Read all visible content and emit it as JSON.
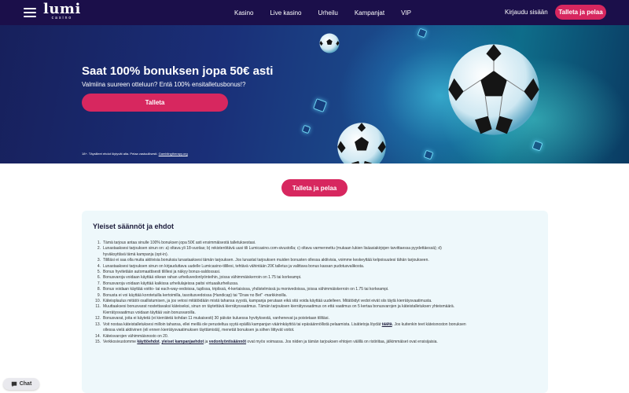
{
  "header": {
    "logo_main": "lumi",
    "logo_sub": "casino",
    "nav": [
      "Kasino",
      "Live kasino",
      "Urheilu",
      "Kampanjat",
      "VIP"
    ],
    "login_label": "Kirjaudu sisään",
    "deposit_label": "Talleta ja pelaa"
  },
  "hero": {
    "title": "Saat 100% bonuksen jopa 50€ asti",
    "subtitle": "Valmiina suureen otteluun? Entä 100% ensitalletusbonus!?",
    "cta_label": "Talleta",
    "legal_prefix": "18+. Täysilleet ehdot löytyvät alta. Pelaa vastuullisesti. ",
    "legal_link": "Gamblingtherapy.org"
  },
  "main_cta_label": "Talleta ja pelaa",
  "terms": {
    "title": "Yleiset säännöt ja ehdot",
    "items": [
      {
        "num": "1.",
        "text": "Tämä tarjous antaa sinulle 100% bonuksen jopa 50€ asti ensimmäisestä talletuksestasi."
      },
      {
        "num": "2.",
        "text": "Lunastaaksesi tarjouksen sinun on: a) oltava yli 18-vuotias; b) rekisteröitävä uusi tili Lumicasino.com-sivustolla; c) oltava varmennettu (mukaan lukien lisäasiakirjojen tarvittaessa pyydettäessä); d)",
        "cont": "hyväksyttävä tämä kampanja (opt-in)."
      },
      {
        "num": "3.",
        "text": "Tililläsi ei saa olla muita aktiivisia bonuksia lunastaaksesi tämän tarjouksen. Jos lunastat tarjouksen muiden bonusten ollessa aktiivisia, voimme keskeyttää kelpoisuutesi tähän tarjoukseen."
      },
      {
        "num": "4.",
        "text": "Lunastaaksesi tarjouksen sinun on kirjauduttava uudelle Lumicasino-tilillesi, tehtävä vähintään 20€ talletus ja valittava bonus kassan pudotusvalikosta."
      },
      {
        "num": "5.",
        "text": "Bonus hyvitetään automaattisesti tilillesi ja näkyy bonus-saldossasi."
      },
      {
        "num": "6.",
        "text": "Bonusvaroja voidaan käyttää oikean rahan urheiluvedonlyönteihin, joissa vähimmäiskerroin on 1.75 tai korkeampi."
      },
      {
        "num": "7.",
        "text": "Bonusvaroja voidaan käyttää kaikissa urheilulajeissa paitsi virtuaaliurheilussa."
      },
      {
        "num": "8.",
        "text": "Bonus voidaan käyttää voitto- tai each-way-vedoissa, tuplissa, triplissä, 4-kertaisissa, yhdistelmissä ja monivedoissa, joissa vähimmäiskerroin on 1.75 tai korkeampi."
      },
      {
        "num": "9.",
        "text": "Bonusta ei voi käyttää korotetuilla kertoimilla, tasoitusvedoissa (Handicap) tai \"Draw no Bet\" -markkinoilla."
      },
      {
        "num": "10.",
        "text": "Käteisplaulus mitätöi osallistumisen, ja jos vetosi mitätöidään mistä tahansa syystä, kampanja perutaan eikä sitä voida käyttää uudelleen. Mitätöidyt vedot eivät siis täytä kierrätysvaatimusta."
      },
      {
        "num": "11.",
        "text": "Muuttaaksesi bonusvarat nostettavaksi käteiseksi, sinun on täytettävä kierrätysvaatimus. Tämän tarjouksen kierrätysvaatimus on että vaatimus on 5 kertaa bonusvarojen ja käteistalletuksen yhteismäärä.",
        "cont": "Kierrätysvaatimus voidaan täyttää vain bonusvaroilla."
      },
      {
        "num": "12.",
        "text": "Bonusvarat, joita ei käytetä (ei kierrätetä kohdan 11 mukaisesti) 30 päivän kuluessa hyvityksestä, vanhenevat ja poistetaan tililtäsi."
      },
      {
        "num": "13.",
        "text_before": "Voit nostaa käteistalletuksesi milloin tahansa, ellei meillä ole perusteltua syytä epäillä kampanjan väärinkäyttöä tai epäsäännöllistä pelaamista. Lisätietoja löydät ",
        "link": "täältä",
        "text_after": ". Jos kuitenkin teet käteisnoston bonuksen",
        "cont": "ollessa vielä aktiivinen (eli ennen kierrätysvaatimuksen täyttämistä), menetät bonuksen ja siihen liittyvät voitot."
      },
      {
        "num": "14.",
        "text": "Käteisvarojen vähimmäisnosto on 20."
      },
      {
        "num": "15.",
        "text_before": "Verkkosivustomme ",
        "link1": "käyttöehdot",
        "mid1": ", ",
        "link2": "yleiset kampanjaehdot",
        "mid2": " ja ",
        "link3": "vedonlyöntisäännöt",
        "text_after": " ovat myös voimassa. Jos niiden ja tämän tarjouksen ehtojen välillä on ristiriitaa, jälkimmäiset ovat ensisijaisia."
      }
    ]
  },
  "chat_label": "Chat",
  "colors": {
    "header_bg": "#1b0f4a",
    "accent": "#d7275f",
    "terms_bg": "#eef8fb"
  }
}
